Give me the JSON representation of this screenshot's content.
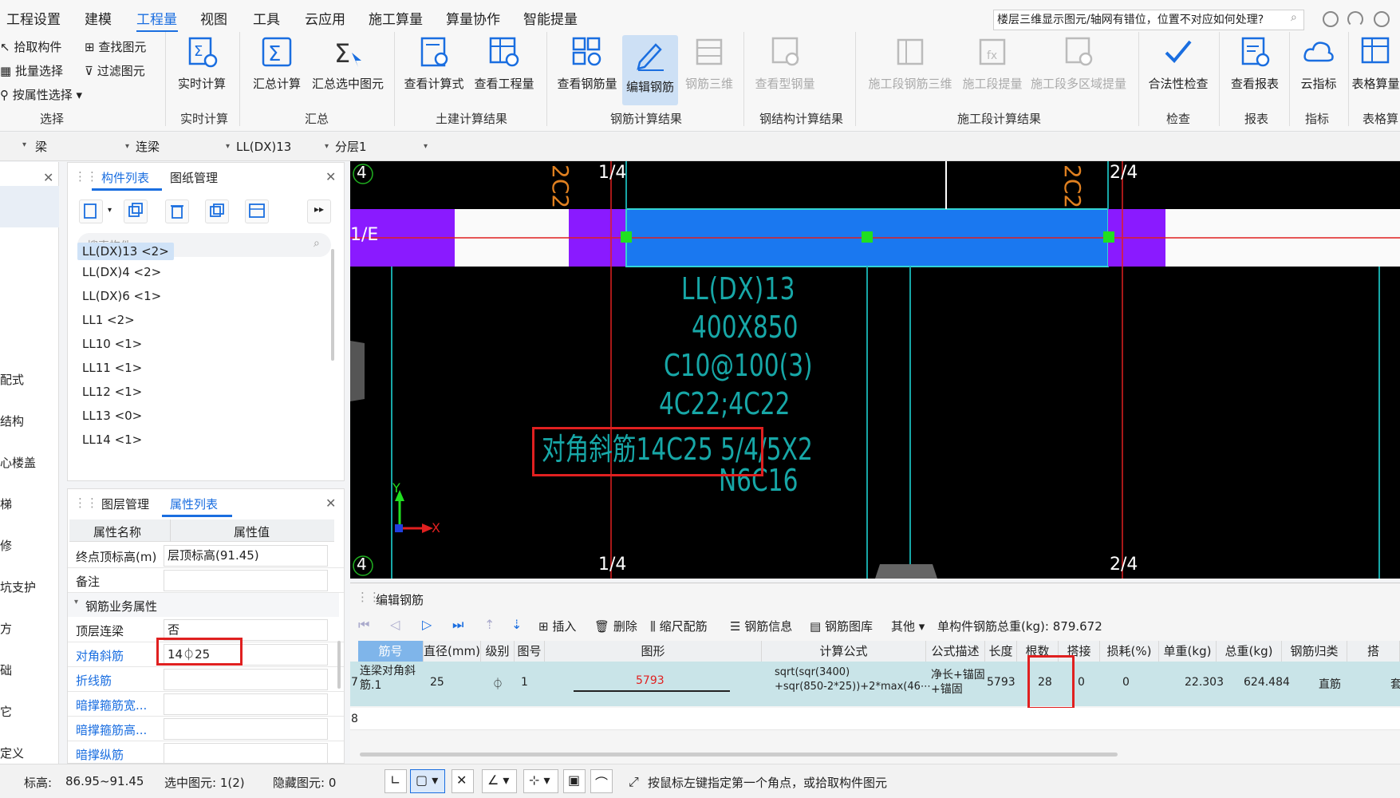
{
  "menu": {
    "items": [
      "工程设置",
      "建模",
      "工程量",
      "视图",
      "工具",
      "云应用",
      "施工算量",
      "算量协作",
      "智能提量"
    ],
    "active": "工程量",
    "search_text": "楼层三维显示图元/轴网有错位，位置不对应如何处理?"
  },
  "ribbon": {
    "select": {
      "pick": "拾取构件",
      "batch": "批量选择",
      "by_attr": "按属性选择",
      "find": "查找图元",
      "filter": "过滤图元",
      "group": "选择"
    },
    "realtime": {
      "calc": "实时计算",
      "group": "实时计算"
    },
    "summary": {
      "sum_calc": "汇总计算",
      "sum_sel": "汇总选中图元",
      "group": "汇总"
    },
    "civil": {
      "view_formula": "查看计算式",
      "view_qty": "查看工程量",
      "group": "土建计算结果"
    },
    "rebar": {
      "view_rebar": "查看钢筋量",
      "edit_rebar": "编辑钢筋",
      "rebar_3d": "钢筋三维",
      "group": "钢筋计算结果"
    },
    "steel": {
      "view_steel": "查看型钢量",
      "group": "钢结构计算结果"
    },
    "stage": {
      "stage_3d": "施工段钢筋三维",
      "stage_qty": "施工段提量",
      "stage_multi": "施工段多区域提量",
      "group": "施工段计算结果"
    },
    "check": {
      "legality": "合法性检查",
      "group": "检查"
    },
    "report": {
      "view_report": "查看报表",
      "group": "报表"
    },
    "index": {
      "cloud_index": "云指标",
      "group": "指标"
    },
    "table": {
      "table_calc": "表格算量",
      "group": "表格算"
    }
  },
  "selector": {
    "type": "梁",
    "subtype": "连梁",
    "component": "LL(DX)13",
    "layer": "分层1"
  },
  "left_strip": [
    "配式",
    "结构",
    "心楼盖",
    "梯",
    "修",
    "坑支护",
    "方",
    "础",
    "它",
    "定义"
  ],
  "comp_panel": {
    "tab_list": "构件列表",
    "tab_drawing": "图纸管理",
    "search_placeholder": "搜索构件...",
    "items": [
      "LL(DX)13 <2>",
      "LL(DX)4 <2>",
      "LL(DX)6 <1>",
      "LL1 <2>",
      "LL10 <1>",
      "LL11 <1>",
      "LL12 <1>",
      "LL13 <0>",
      "LL14 <1>"
    ]
  },
  "prop_panel": {
    "tab_layers": "图层管理",
    "tab_props": "属性列表",
    "col_name": "属性名称",
    "col_value": "属性值",
    "rows": [
      {
        "name": "终点顶标高(m)",
        "value": "层顶标高(91.45)"
      },
      {
        "name": "备注",
        "value": ""
      }
    ],
    "section": "钢筋业务属性",
    "rebar_rows": [
      {
        "name": "顶层连梁",
        "value": "否"
      },
      {
        "name": "对角斜筋",
        "value": "14⏀25"
      },
      {
        "name": "折线筋",
        "value": ""
      },
      {
        "name": "暗撑箍筋宽...",
        "value": ""
      },
      {
        "name": "暗撑箍筋高...",
        "value": ""
      },
      {
        "name": "暗撑纵筋",
        "value": ""
      }
    ]
  },
  "canvas": {
    "axis_top": [
      "4",
      "1/4",
      "2/4"
    ],
    "axis_bottom": [
      "4",
      "1/4",
      "2/4"
    ],
    "axis_left": "1/E",
    "label_top1": "2C2",
    "label_top2": "2C2",
    "annotations": [
      "LL(DX)13",
      "400X850",
      "C10@100(3)",
      "4C22;4C22",
      "对角斜筋14C25 5/4/5X2",
      "N6C16"
    ],
    "ucs_y": "Y",
    "ucs_x": "X"
  },
  "edit_panel": {
    "title": "编辑钢筋",
    "tools": {
      "insert": "插入",
      "delete": "删除",
      "scale": "缩尺配筋",
      "info": "钢筋信息",
      "library": "钢筋图库",
      "other": "其他",
      "total": "单构件钢筋总重(kg): 879.672"
    },
    "headers": [
      "筋号",
      "直径(mm)",
      "级别",
      "图号",
      "图形",
      "计算公式",
      "公式描述",
      "长度",
      "根数",
      "搭接",
      "损耗(%)",
      "单重(kg)",
      "总重(kg)",
      "钢筋归类",
      "搭"
    ],
    "row": {
      "index": "7",
      "name": "连梁对角斜筋.1",
      "diameter": "25",
      "grade": "⏀",
      "shape_no": "1",
      "shape_len": "5793",
      "formula1": "sqrt(sqr(3400)",
      "formula2": "+sqr(850-2*25))+2*max(46⋯",
      "desc1": "净长+锚固",
      "desc2": "+锚固",
      "length": "5793",
      "count": "28",
      "lap": "0",
      "loss": "0",
      "unit_w": "22.303",
      "total_w": "624.484",
      "category": "直筋",
      "extra": "套"
    },
    "row2_index": "8"
  },
  "status": {
    "elevation_label": "标高:",
    "elevation": "86.95~91.45",
    "selected": "选中图元: 1(2)",
    "hidden": "隐藏图元: 0",
    "hint": "按鼠标左键指定第一个角点，或拾取构件图元"
  },
  "colors": {
    "accent": "#1a6ee0",
    "beam_blue": "#1a78f0",
    "purple": "#8a1aff",
    "cad_cyan": "#17a7a7",
    "axis_red": "#e02020"
  }
}
